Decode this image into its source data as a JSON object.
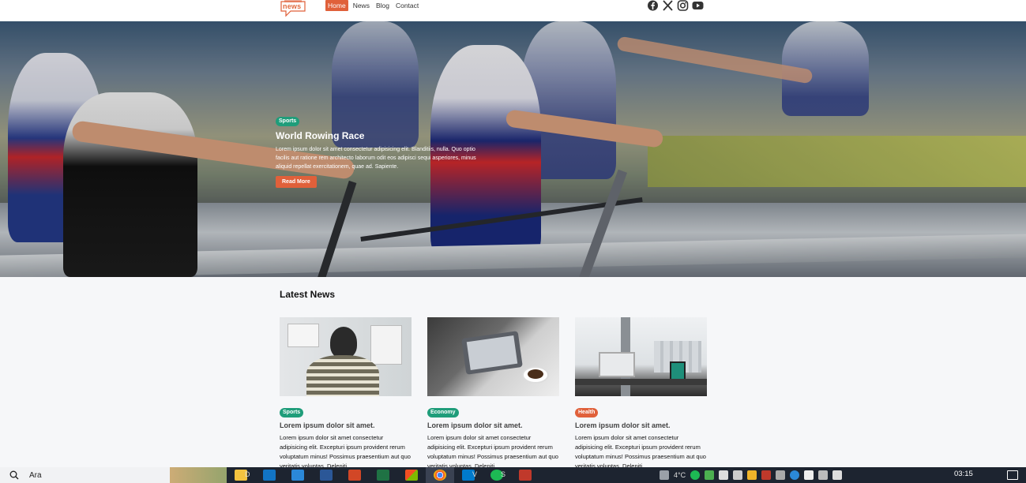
{
  "navbar": {
    "logo_text": "news",
    "links": [
      {
        "label": "Home",
        "active": true
      },
      {
        "label": "News",
        "active": false
      },
      {
        "label": "Blog",
        "active": false
      },
      {
        "label": "Contact",
        "active": false
      }
    ],
    "social_icons": [
      "facebook-icon",
      "x-icon",
      "instagram-icon",
      "youtube-icon"
    ]
  },
  "hero": {
    "category": "Sports",
    "title": "World Rowing Race",
    "description": "Lorem ipsum dolor sit amet consectetur adipisicing elit. Blanditiis, nulla. Quo optio facilis aut ratione rem architecto laborum odit eos adipisci sequi asperiores, minus aliquid repellat exercitationem, quae ad. Sapiente.",
    "button_label": "Read More"
  },
  "latest": {
    "title": "Latest News",
    "cards": [
      {
        "category": "Sports",
        "title": "Lorem ipsum dolor sit amet.",
        "description": "Lorem ipsum dolor sit amet consectetur adipisicing elit. Excepturi ipsum provident rerum voluptatum minus! Possimus praesentium aut quo veritatis voluptas. Deleniti"
      },
      {
        "category": "Economy",
        "title": "Lorem ipsum dolor sit amet.",
        "description": "Lorem ipsum dolor sit amet consectetur adipisicing elit. Excepturi ipsum provident rerum voluptatum minus! Possimus praesentium aut quo veritatis voluptas. Deleniti"
      },
      {
        "category": "Health",
        "title": "Lorem ipsum dolor sit amet.",
        "description": "Lorem ipsum dolor sit amet consectetur adipisicing elit. Excepturi ipsum provident rerum voluptatum minus! Possimus praesentium aut quo veritatis voluptas. Deleniti"
      }
    ]
  },
  "taskbar": {
    "search_text": "Ara",
    "apps": [
      {
        "icon": "file-explorer-icon",
        "label": "D"
      },
      {
        "icon": "outlook-icon",
        "label": ""
      },
      {
        "icon": "mail-icon",
        "label": ""
      },
      {
        "icon": "word-icon",
        "label": ""
      },
      {
        "icon": "powerpoint-icon",
        "label": ""
      },
      {
        "icon": "excel-icon",
        "label": ""
      },
      {
        "icon": "store-icon",
        "label": ""
      },
      {
        "icon": "chrome-icon",
        "label": ""
      },
      {
        "icon": "vscode-icon",
        "label": "V"
      },
      {
        "icon": "spotify-icon",
        "label": "S"
      },
      {
        "icon": "app-icon",
        "label": ""
      }
    ],
    "temperature": "4°C",
    "clock": "03:15",
    "colors": {
      "accent": "#e0603a",
      "tag_green": "#1f9d7a",
      "taskbar_bg": "#1d2430"
    }
  }
}
